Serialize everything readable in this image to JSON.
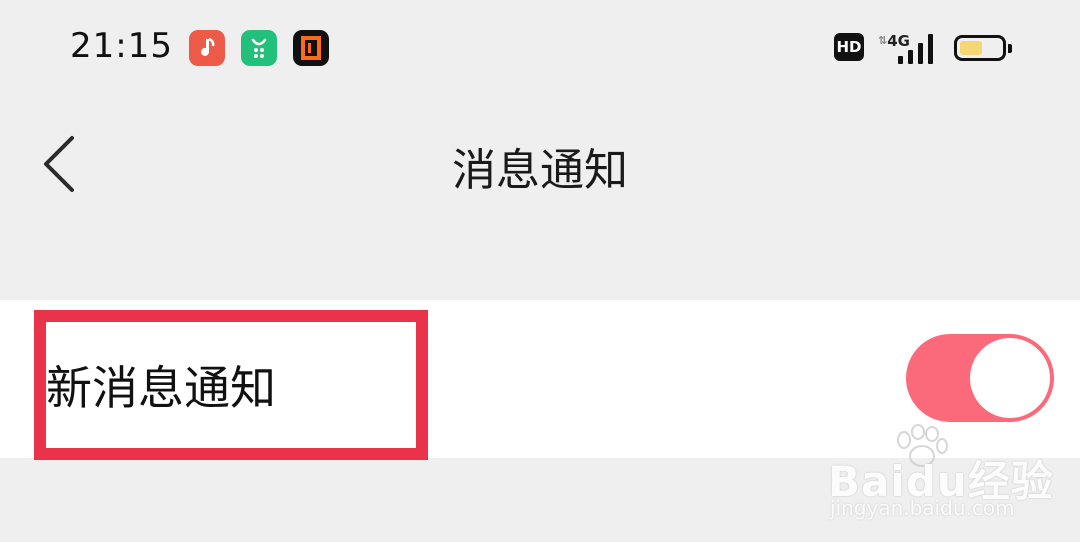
{
  "status_bar": {
    "time": "21:15",
    "apps": [
      {
        "name": "music-app-icon",
        "glyph": "♪",
        "color": "#ee5a48"
      },
      {
        "name": "green-app-icon",
        "glyph": "ʊ",
        "color": "#22c07a"
      },
      {
        "name": "orange-app-icon",
        "glyph": "◘",
        "color": "#ff6a1a"
      }
    ],
    "hd_label": "HD",
    "network_label": "4G",
    "battery_level": 0.55
  },
  "nav": {
    "back_icon": "chevron-left-icon",
    "title": "消息通知"
  },
  "settings": {
    "new_message_notification": {
      "label": "新消息通知",
      "enabled": true,
      "toggle_color": "#fa6a7a"
    }
  },
  "annotation": {
    "highlight_color": "#e8334a"
  },
  "watermark": {
    "brand": "Baidu经验",
    "url": "jingyan.baidu.com"
  }
}
